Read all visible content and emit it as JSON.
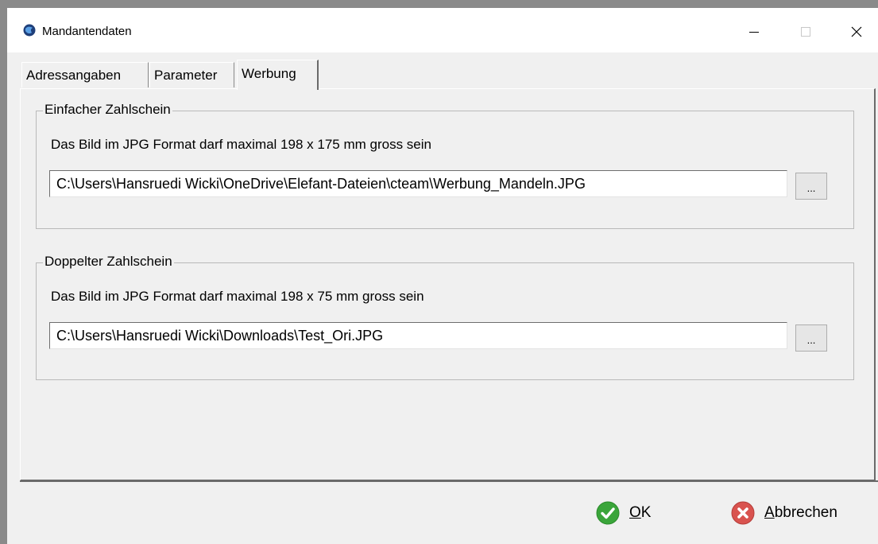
{
  "window": {
    "title": "Mandantendaten"
  },
  "tabs": [
    {
      "label": "Adressangaben",
      "active": false
    },
    {
      "label": "Parameter",
      "active": false
    },
    {
      "label": "Werbung",
      "active": true
    }
  ],
  "groups": [
    {
      "legend": "Einfacher Zahlschein",
      "description": "Das Bild im JPG Format darf maximal 198 x 175 mm gross sein",
      "path_value": "C:\\Users\\Hansruedi Wicki\\OneDrive\\Elefant-Dateien\\cteam\\Werbung_Mandeln.JPG",
      "browse_label": "..."
    },
    {
      "legend": "Doppelter Zahlschein",
      "description": "Das Bild im JPG Format darf maximal 198 x 75 mm gross sein",
      "path_value": "C:\\Users\\Hansruedi Wicki\\Downloads\\Test_Ori.JPG",
      "browse_label": "..."
    }
  ],
  "buttons": {
    "ok_accel": "O",
    "ok_rest": "K",
    "cancel_accel": "A",
    "cancel_rest": "bbrechen"
  },
  "icons": {
    "app": "app-globe-icon",
    "ok": "check-circle-icon",
    "cancel": "x-circle-icon"
  },
  "colors": {
    "ok_green": "#3aa53a",
    "cancel_red": "#d9534f"
  }
}
